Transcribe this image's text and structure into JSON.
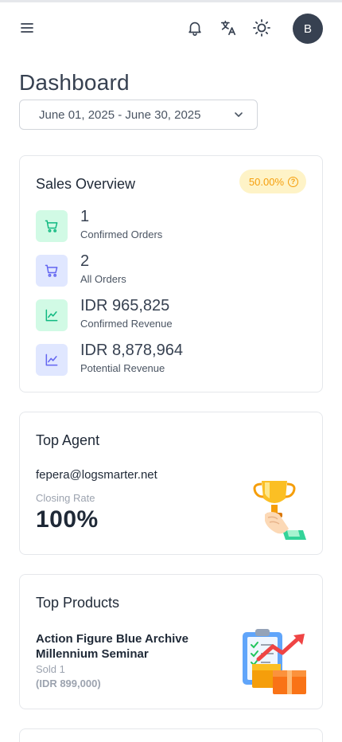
{
  "header": {
    "avatar_initial": "B",
    "icons": [
      "menu-icon",
      "bell-icon",
      "translate-icon",
      "sun-icon"
    ]
  },
  "page": {
    "title": "Dashboard",
    "date_range": "June 01, 2025 - June 30, 2025"
  },
  "sales_overview": {
    "title": "Sales Overview",
    "badge": "50.00%",
    "stats": [
      {
        "value": "1",
        "label": "Confirmed Orders",
        "icon": "cart-icon",
        "color": "green"
      },
      {
        "value": "2",
        "label": "All Orders",
        "icon": "cart-icon",
        "color": "purple"
      },
      {
        "value": "IDR 965,825",
        "label": "Confirmed Revenue",
        "icon": "chart-line-icon",
        "color": "green"
      },
      {
        "value": "IDR 8,878,964",
        "label": "Potential Revenue",
        "icon": "chart-line-icon",
        "color": "purple"
      }
    ]
  },
  "top_agent": {
    "title": "Top Agent",
    "email": "fepera@logsmarter.net",
    "rate_label": "Closing Rate",
    "rate": "100%"
  },
  "top_products": {
    "title": "Top Products",
    "name": "Action Figure Blue Archive Millennium Seminar",
    "sold": "Sold 1",
    "price": "(IDR 899,000)"
  },
  "colors": {
    "green_bg": "#d1fae5",
    "green_icon": "#10b981",
    "purple_bg": "#e0e7ff",
    "purple_icon": "#6366f1",
    "badge_bg": "#fef3c7",
    "badge_text": "#f59e0b"
  }
}
